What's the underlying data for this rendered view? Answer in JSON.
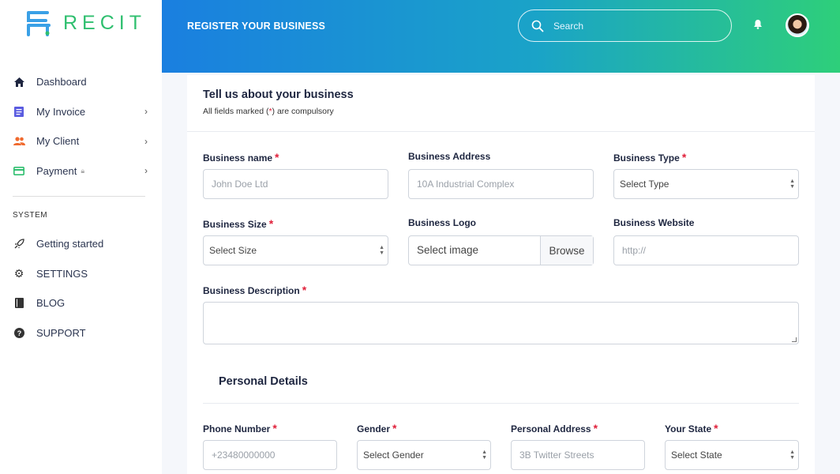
{
  "brand": {
    "name": "RECIT",
    "accent": "#2fbf6f",
    "mark_color": "#3aa0e6"
  },
  "sidebar": {
    "items": [
      {
        "label": "Dashboard",
        "icon": "home-icon",
        "color": "#1e2640",
        "chevron": false,
        "lock": false
      },
      {
        "label": "My Invoice",
        "icon": "invoice-icon",
        "color": "#5a5ce0",
        "chevron": true,
        "lock": false
      },
      {
        "label": "My Client",
        "icon": "users-icon",
        "color": "#f06a2e",
        "chevron": true,
        "lock": false
      },
      {
        "label": "Payment",
        "icon": "card-icon",
        "color": "#2fbf6f",
        "chevron": true,
        "lock": true
      }
    ],
    "section_label": "SYSTEM",
    "system_items": [
      {
        "label": "Getting started",
        "icon": "rocket-icon"
      },
      {
        "label": "SETTINGS",
        "icon": "gear-icon"
      },
      {
        "label": "BLOG",
        "icon": "book-icon"
      },
      {
        "label": "SUPPORT",
        "icon": "help-icon"
      }
    ]
  },
  "header": {
    "title": "REGISTER YOUR BUSINESS",
    "search_placeholder": "Search"
  },
  "form": {
    "title": "Tell us about your business",
    "subtitle_pre": "All fields marked (",
    "subtitle_star": "*",
    "subtitle_post": ") are compulsory",
    "required_mark": "*",
    "business_name": {
      "label": "Business name",
      "placeholder": "John Doe Ltd"
    },
    "business_address": {
      "label": "Business Address",
      "placeholder": "10A Industrial Complex"
    },
    "business_type": {
      "label": "Business Type",
      "value": "Select Type"
    },
    "business_size": {
      "label": "Business Size",
      "value": "Select Size"
    },
    "business_logo": {
      "label": "Business Logo",
      "value": "Select image",
      "button": "Browse"
    },
    "business_website": {
      "label": "Business Website",
      "placeholder": "http://"
    },
    "business_description": {
      "label": "Business Description",
      "value": ""
    },
    "personal_title": "Personal Details",
    "phone": {
      "label": "Phone Number",
      "placeholder": "+23480000000"
    },
    "gender": {
      "label": "Gender",
      "value": "Select Gender"
    },
    "personal_address": {
      "label": "Personal Address",
      "placeholder": "3B Twitter Streets"
    },
    "state": {
      "label": "Your State",
      "value": "Select State"
    }
  }
}
